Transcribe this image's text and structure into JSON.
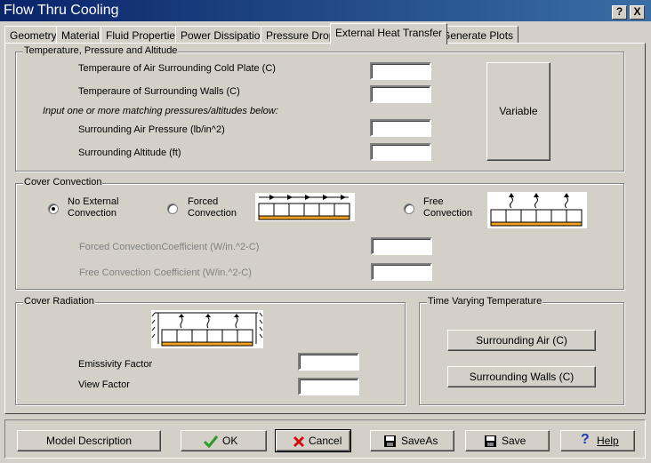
{
  "window": {
    "title": "Flow Thru Cooling",
    "help_btn": "?",
    "close_btn": "X"
  },
  "tabs": [
    {
      "label": "Geometry"
    },
    {
      "label": "Material"
    },
    {
      "label": "Fluid Properties"
    },
    {
      "label": "Power Dissipation"
    },
    {
      "label": "Pressure Drop"
    },
    {
      "label": "External Heat Transfer",
      "active": true
    },
    {
      "label": "Generate Plots"
    }
  ],
  "tpa": {
    "legend": "Temperature, Pressure and Altitude",
    "air_temp_label": "Temperaure of Air Surrounding Cold Plate (C)",
    "air_temp_value": "",
    "walls_temp_label": "Temperaure of Surrounding Walls (C)",
    "walls_temp_value": "",
    "hint": "Input one or more matching pressures/altitudes below:",
    "pressure_label": "Surrounding Air Pressure (lb/in^2)",
    "pressure_value": "",
    "altitude_label": "Surrounding Altitude (ft)",
    "altitude_value": "",
    "variable_btn": "Variable"
  },
  "convection": {
    "legend": "Cover Convection",
    "no_external_line1": "No External",
    "no_external_line2": "Convection",
    "forced_line1": "Forced",
    "forced_line2": "Convection",
    "free_line1": "Free",
    "free_line2": "Convection",
    "selected": "no_external",
    "forced_coef_label": "Forced ConvectionCoefficient (W/in.^2-C)",
    "forced_coef_value": "",
    "free_coef_label": "Free Convection Coefficient (W/in.^2-C)",
    "free_coef_value": ""
  },
  "radiation": {
    "legend": "Cover Radiation",
    "emissivity_label": "Emissivity Factor",
    "emissivity_value": "",
    "view_label": "View Factor",
    "view_value": ""
  },
  "time_varying": {
    "legend": "Time Varying Temperature",
    "air_btn": "Surrounding Air (C)",
    "walls_btn": "Surrounding Walls (C)"
  },
  "footer": {
    "model_desc": "Model Description",
    "ok": "OK",
    "cancel": "Cancel",
    "saveas": "SaveAs",
    "save": "Save",
    "help": "Help"
  },
  "colors": {
    "title_start": "#0a246a",
    "title_end": "#3a6ea5",
    "plate": "#f0a020",
    "ok_check": "#2a9a2a",
    "cancel_x": "#d01010"
  }
}
